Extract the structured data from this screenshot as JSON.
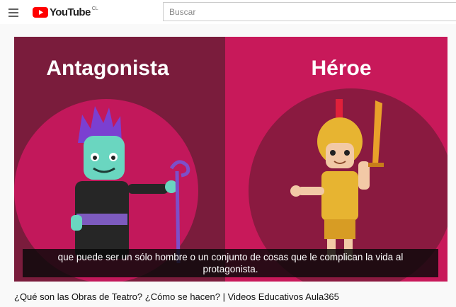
{
  "header": {
    "brand_text": "YouTube",
    "region": "CL",
    "search_placeholder": "Buscar",
    "brand_color": "#ff0000"
  },
  "video": {
    "left_panel_heading": "Antagonista",
    "right_panel_heading": "Héroe",
    "caption_line1": "que puede ser un sólo hombre o un conjunto de cosas que le complican la vida al",
    "caption_line2": "protagonista.",
    "left_panel_color": "#7a1c3c",
    "right_panel_color": "#c8195a"
  },
  "title": "¿Qué son las Obras de Teatro? ¿Cómo se hacen? | Videos Educativos Aula365"
}
